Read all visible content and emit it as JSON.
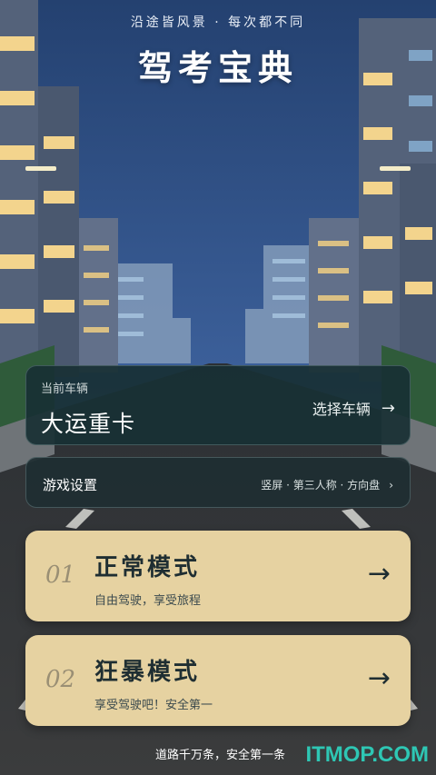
{
  "header": {
    "slogan": "沿途皆风景 · 每次都不同",
    "title": "驾考宝典"
  },
  "vehicle": {
    "caption": "当前车辆",
    "name": "大运重卡",
    "action_label": "选择车辆",
    "action_arrow": "→"
  },
  "settings": {
    "label": "游戏设置",
    "value": "竖屏 · 第三人称 · 方向盘",
    "chevron": "›"
  },
  "modes": [
    {
      "number": "01",
      "title": "正常模式",
      "subtitle": "自由驾驶，享受旅程",
      "arrow": "→"
    },
    {
      "number": "02",
      "title": "狂暴模式",
      "subtitle": "享受驾驶吧！安全第一",
      "arrow": "→"
    }
  ],
  "footer": {
    "text": "道路千万条，安全第一条"
  },
  "watermark": "ITMOP.COM",
  "colors": {
    "sky_top": "#2d4a7a",
    "sky_bottom": "#5b7bb5",
    "card_dark": "#183034",
    "card_gold": "#e6d2a1",
    "watermark": "#2ec7b4"
  }
}
